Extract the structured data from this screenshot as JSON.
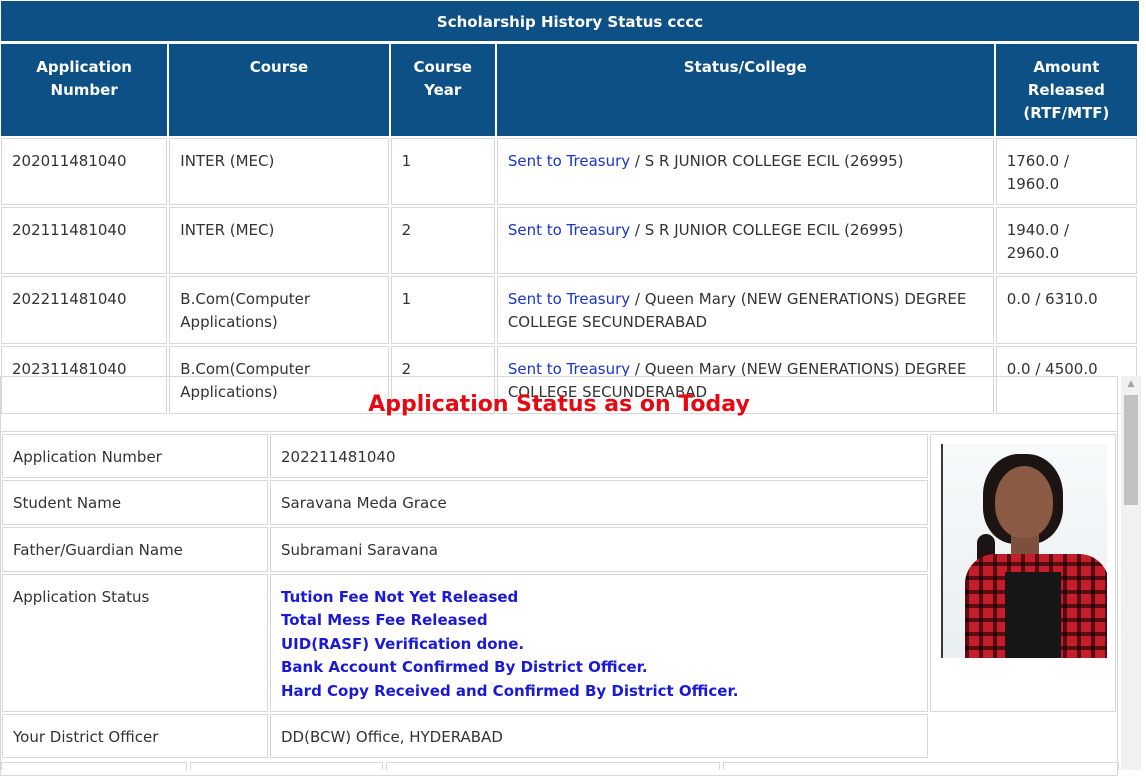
{
  "history": {
    "title": "Scholarship History Status cccc",
    "headers": {
      "app_no": "Application Number",
      "course": "Course",
      "course_year": "Course Year",
      "status_college": "Status/College",
      "amount": "Amount Released (RTF/MTF)"
    },
    "rows": [
      {
        "app_no": "202011481040",
        "course": "INTER (MEC)",
        "year": "1",
        "status_link": "Sent to Treasury",
        "college": " / S R JUNIOR COLLEGE ECIL (26995)",
        "amount": "1760.0 / 1960.0"
      },
      {
        "app_no": "202111481040",
        "course": "INTER (MEC)",
        "year": "2",
        "status_link": "Sent to Treasury",
        "college": " / S R JUNIOR COLLEGE ECIL (26995)",
        "amount": "1940.0 / 2960.0"
      },
      {
        "app_no": "202211481040",
        "course": "B.Com(Computer Applications)",
        "year": "1",
        "status_link": "Sent to Treasury",
        "college": " / Queen Mary (NEW GENERATIONS) DEGREE COLLEGE SECUNDERABAD",
        "amount": "0.0 / 6310.0"
      },
      {
        "app_no": "202311481040",
        "course": "B.Com(Computer Applications)",
        "year": "2",
        "status_link": "Sent to Treasury",
        "college": " / Queen Mary (NEW GENERATIONS) DEGREE COLLEGE SECUNDERABAD",
        "amount": "0.0 / 4500.0"
      }
    ]
  },
  "status": {
    "title": "Application Status as on Today",
    "fields": {
      "app_no_label": "Application Number",
      "app_no_value": "202211481040",
      "student_label": "Student Name",
      "student_value": "Saravana Meda Grace",
      "father_label": "Father/Guardian Name",
      "father_value": "Subramani Saravana",
      "app_status_label": "Application Status",
      "district_label": "Your District Officer",
      "district_value": "DD(BCW) Office, HYDERABAD"
    },
    "status_lines": [
      "Tution Fee Not Yet Released",
      "Total Mess Fee Released",
      "UID(RASF) Verification done.",
      "Bank Account Confirmed By District Officer.",
      "Hard Copy Received and Confirmed By District Officer."
    ]
  },
  "colors": {
    "header_bg": "#0d5086",
    "link": "#1a35c9",
    "status_title": "#e50914",
    "status_text": "#1a1ad6"
  }
}
